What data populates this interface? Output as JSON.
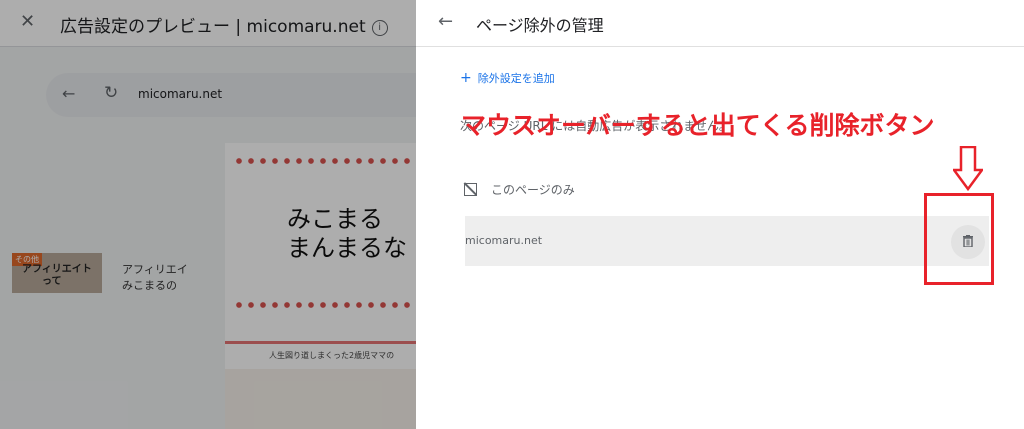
{
  "background": {
    "window_title": "広告設定のプレビュー | micomaru.net",
    "info_icon": "i",
    "url": "micomaru.net",
    "site": {
      "title_line1": "みこまる",
      "title_line2": "まんまるな",
      "tagline": "人生図り道しまくった2歳児ママの",
      "card_badge": "その他",
      "card_thumb_line1": "アフィリエイト",
      "card_thumb_line2": "って",
      "card_side_line1": "アフィリエイ",
      "card_side_line2": "みこまるの"
    }
  },
  "panel": {
    "title": "ページ除外の管理",
    "add_exclusion_label": "除外設定を追加",
    "description": "次のページ URL には自動広告が表示されません。",
    "section_title": "このページのみ",
    "rows": [
      {
        "url": "micomaru.net"
      }
    ]
  },
  "annotation": {
    "text": "マウスオーバーすると出てくる削除ボタン",
    "color": "#e8222a"
  },
  "icons": {
    "close": "close-icon",
    "back": "arrow-back-icon",
    "reload": "reload-icon",
    "add": "plus-icon",
    "page": "page-off-icon",
    "delete": "trash-icon"
  },
  "colors": {
    "link": "#1a73e8",
    "row_bg": "#eeeeee",
    "overlay": "rgba(0,0,0,0.32)"
  }
}
